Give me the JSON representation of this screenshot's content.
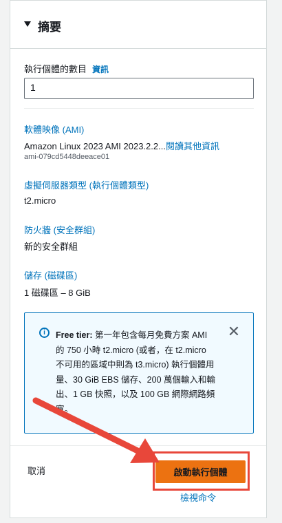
{
  "summary": {
    "title": "摘要"
  },
  "instances": {
    "label": "執行個體的數目",
    "info_link": "資訊",
    "value": "1"
  },
  "ami": {
    "heading": "軟體映像 (AMI)",
    "name": "Amazon Linux 2023 AMI 2023.2.2...",
    "more_link": "閱讀其他資訊",
    "id": "ami-079cd5448deeace01"
  },
  "server_type": {
    "heading": "虛擬伺服器類型 (執行個體類型)",
    "value": "t2.micro"
  },
  "firewall": {
    "heading": "防火牆 (安全群組)",
    "value": "新的安全群組"
  },
  "storage": {
    "heading": "儲存 (磁碟區)",
    "value": "1 磁碟區 – 8 GiB"
  },
  "alert": {
    "bold": "Free tier:",
    "text": " 第一年包含每月免費方案 AMI 的 750 小時 t2.micro (或者，在 t2.micro 不可用的區域中則為 t3.micro) 執行個體用量、30 GiB EBS 儲存、200 萬個輸入和輸出、1 GB 快照，以及 100 GB 網際網路頻寬。"
  },
  "footer": {
    "cancel_label": "取消",
    "launch_label": "啟動執行個體",
    "view_command_label": "檢視命令"
  },
  "colors": {
    "accent": "#0073bb",
    "primary_button": "#ec7211",
    "annotation": "#e8473a"
  }
}
